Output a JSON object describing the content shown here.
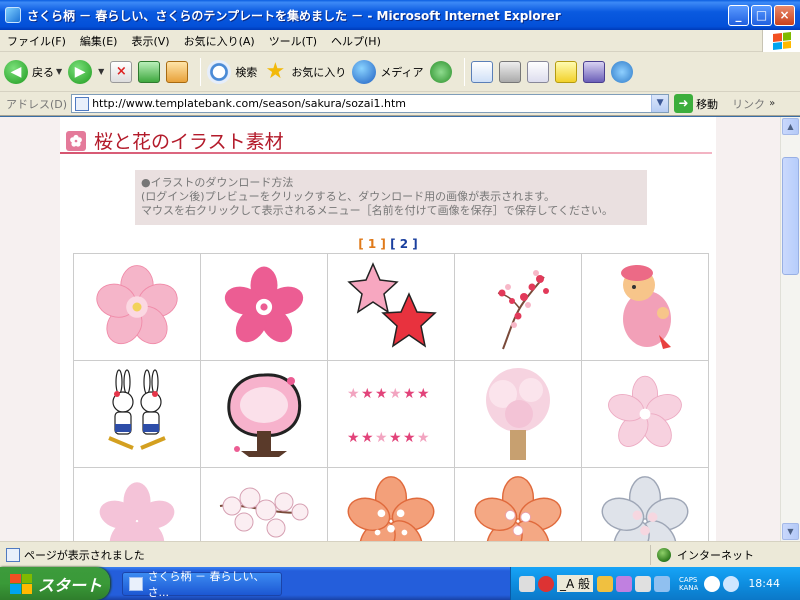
{
  "window": {
    "title": "さくら柄 － 春らしい、さくらのテンプレートを集めました － - Microsoft Internet Explorer",
    "controls": [
      "_",
      "□",
      "×"
    ]
  },
  "menu": [
    "ファイル(F)",
    "編集(E)",
    "表示(V)",
    "お気に入り(A)",
    "ツール(T)",
    "ヘルプ(H)"
  ],
  "toolbar": {
    "back": "戻る",
    "search": "検索",
    "favorites": "お気に入り",
    "media": "メディア"
  },
  "address": {
    "label": "アドレス(D)",
    "url": "http://www.templatebank.com/season/sakura/sozai1.htm",
    "go": "移動",
    "links": "リンク"
  },
  "page": {
    "heading": "桜と花のイラスト素材",
    "notice": [
      "●イラストのダウンロード方法",
      "(ログイン後)プレビューをクリックすると、ダウンロード用の画像が表示されます。",
      "マウスを右クリックして表示されるメニュー［名前を付けて画像を保存］で保存してください。"
    ],
    "pager": {
      "p1": "[ 1 ]",
      "p2": "[ 2 ]"
    }
  },
  "status": {
    "text": "ページが表示されました",
    "zone": "インターネット"
  },
  "taskbar": {
    "start": "スタート",
    "item": "さくら柄 － 春らしい、さ...",
    "ime": "_A 般",
    "caps1": "CAPS",
    "caps2": "KANA",
    "clock": "18:44"
  },
  "colors": {
    "heading": "#b31a2a",
    "pager_current": "#e07a1a",
    "pager_link": "#1a3f9e"
  }
}
